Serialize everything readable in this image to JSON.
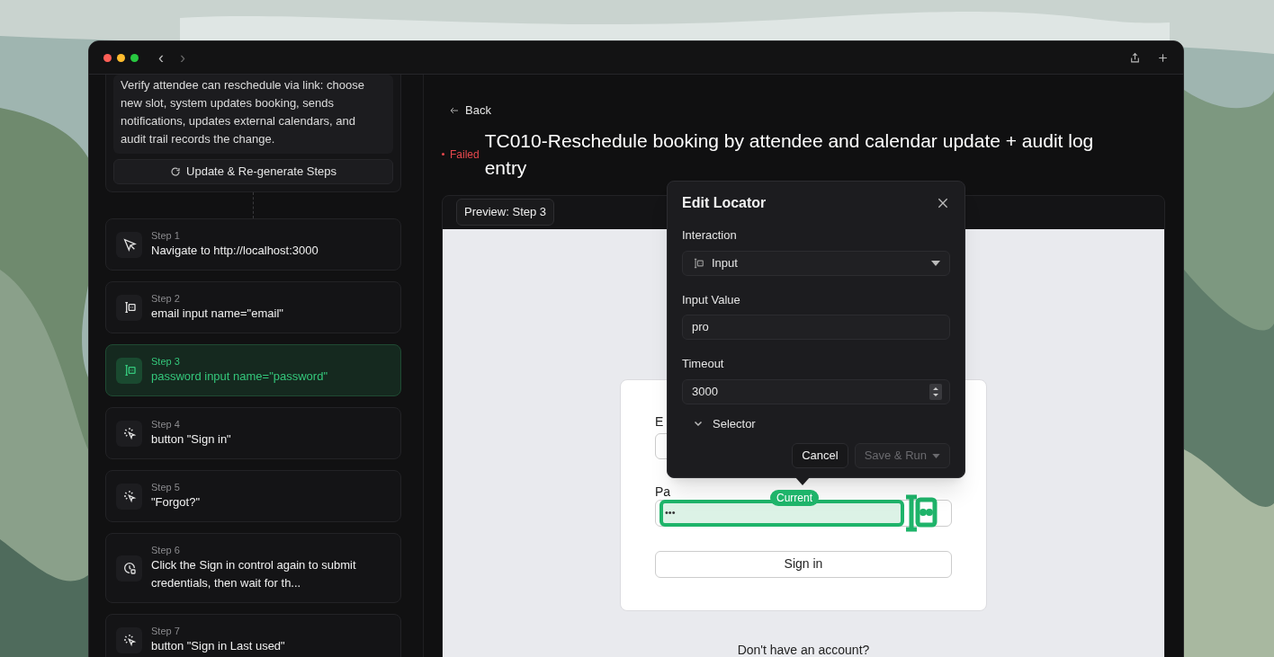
{
  "window": {
    "nav": [
      "‹",
      "›"
    ]
  },
  "sidebar": {
    "description": "Verify attendee can reschedule via link: choose new slot, system updates booking, sends notifications, updates external calendars, and audit trail records the change.",
    "regenerate_button": "Update & Re-generate Steps",
    "steps": [
      {
        "label": "Step 1",
        "text": "Navigate to http://localhost:3000",
        "kind": "navigate",
        "selected": false
      },
      {
        "label": "Step 2",
        "text": "email input name=\"email\"",
        "kind": "input",
        "selected": false
      },
      {
        "label": "Step 3",
        "text": "password input name=\"password\"",
        "kind": "input",
        "selected": true
      },
      {
        "label": "Step 4",
        "text": "button \"Sign in\"",
        "kind": "click",
        "selected": false
      },
      {
        "label": "Step 5",
        "text": "\"Forgot?\"",
        "kind": "click",
        "selected": false
      },
      {
        "label": "Step 6",
        "text": "Click the Sign in control again to submit credentials, then wait for th...",
        "kind": "wait",
        "selected": false
      },
      {
        "label": "Step 7",
        "text": "button \"Sign in Last used\"",
        "kind": "click",
        "selected": false
      }
    ]
  },
  "main": {
    "back": "Back",
    "status": "Failed",
    "title": "TC010-Reschedule booking by attendee and calendar update + audit log entry"
  },
  "preview": {
    "badge": "Preview: Step 3",
    "email_label": "E",
    "password_label": "Pa",
    "password_value": "•••",
    "current_badge": "Current",
    "sign_in_button": "Sign in",
    "signup_prompt": "Don't have an account?"
  },
  "dialog": {
    "title": "Edit Locator",
    "interaction_label": "Interaction",
    "interaction_value": "Input",
    "input_value_label": "Input Value",
    "input_value": "pro",
    "timeout_label": "Timeout",
    "timeout_value": "3000",
    "selector": {
      "label": "Selector",
      "expanded": false
    },
    "cancel_button": "Cancel",
    "save_button": {
      "label": "Save & Run",
      "disabled": true
    }
  }
}
